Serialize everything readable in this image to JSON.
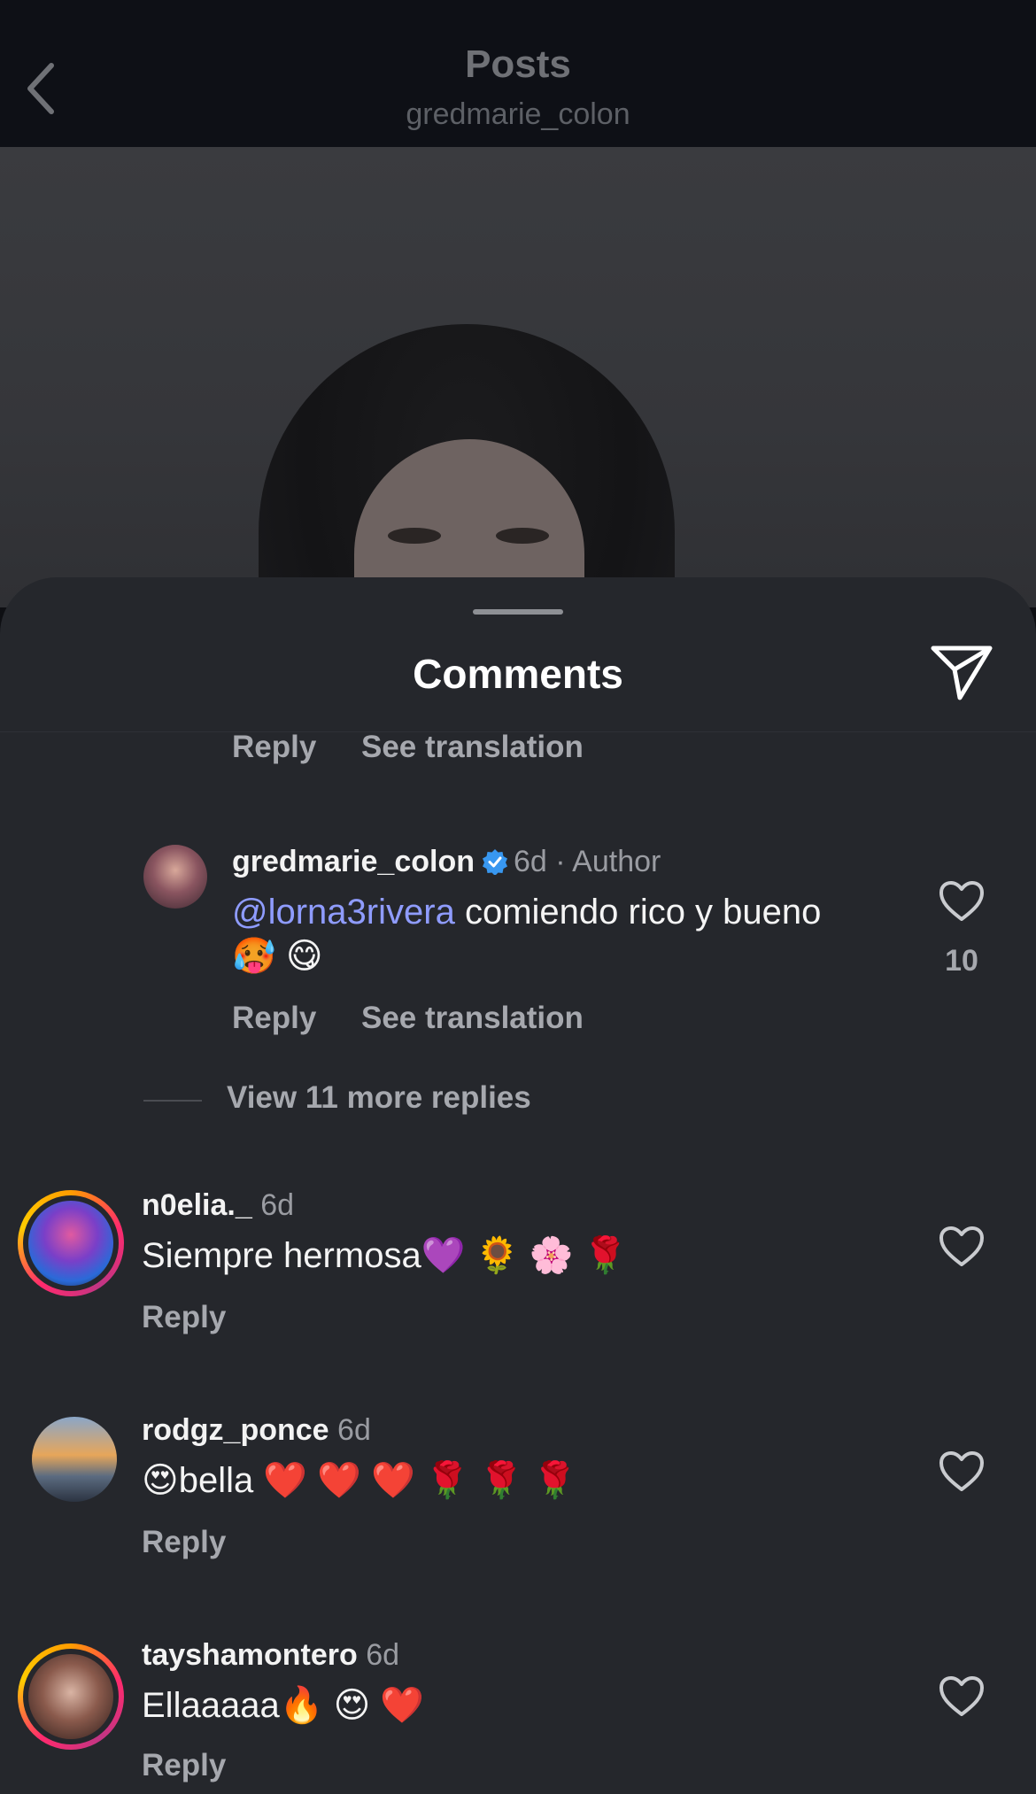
{
  "header": {
    "title": "Posts",
    "subtitle": "gredmarie_colon"
  },
  "sheet": {
    "title": "Comments"
  },
  "partial_comment": {
    "reply_label": "Reply",
    "translate_label": "See translation"
  },
  "author_reply": {
    "username": "gredmarie_colon",
    "time": "6d",
    "badge": "· Author",
    "mention": "@lorna3rivera",
    "text": " comiendo rico y bueno",
    "text_line2": "🥵 😋",
    "likes": "10",
    "reply_label": "Reply",
    "translate_label": "See translation"
  },
  "view_more": "View 11 more replies",
  "comments": [
    {
      "username": "n0elia._",
      "time": "6d",
      "text": "Siempre hermosa💜 🌻 🌸 🌹",
      "reply_label": "Reply"
    },
    {
      "username": "rodgz_ponce",
      "time": "6d",
      "text": "😍bella ❤️ ❤️ ❤️ 🌹 🌹 🌹",
      "reply_label": "Reply"
    },
    {
      "username": "tayshamontero",
      "time": "6d",
      "text": "Ellaaaaa🔥 😍 ❤️",
      "reply_label": "Reply"
    }
  ],
  "icons": {
    "back": "chevron-left-icon",
    "share": "paper-plane-icon",
    "like": "heart-outline-icon",
    "verified": "verified-badge-icon"
  },
  "colors": {
    "sheet_bg": "#25272c",
    "mention": "#8f9cff",
    "verified": "#3897f0"
  }
}
